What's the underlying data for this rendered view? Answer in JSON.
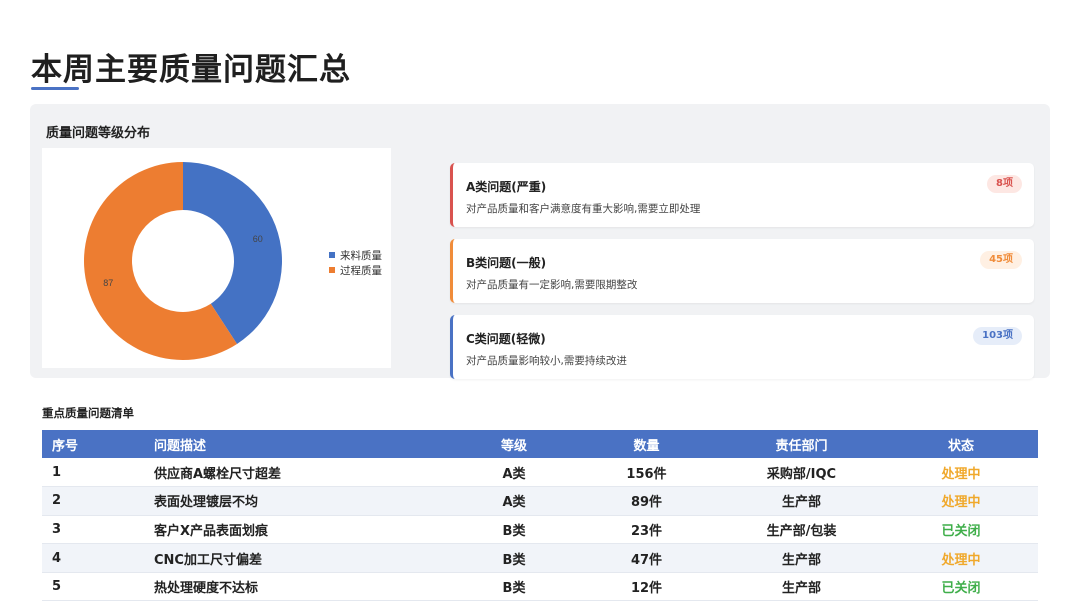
{
  "page": {
    "title": "本周主要质量问题汇总"
  },
  "distribution": {
    "title": "质量问题等级分布",
    "chart_data": {
      "type": "pie",
      "donut": true,
      "slices": [
        {
          "label": "来料质量",
          "value": 60,
          "color": "#4472c4"
        },
        {
          "label": "过程质量",
          "value": 87,
          "color": "#ed7d31"
        }
      ],
      "legend_placement": "right"
    }
  },
  "levels": [
    {
      "title": "A类问题(严重)",
      "desc": "对产品质量和客户满意度有重大影响,需要立即处理",
      "badge": "8项",
      "color": "#d9534f",
      "badge_bg": "#fde7e3",
      "badge_fg": "#d9534f"
    },
    {
      "title": "B类问题(一般)",
      "desc": "对产品质量有一定影响,需要限期整改",
      "badge": "45项",
      "color": "#f08c3a",
      "badge_bg": "#fff0e3",
      "badge_fg": "#f08c3a"
    },
    {
      "title": "C类问题(轻微)",
      "desc": "对产品质量影响较小,需要持续改进",
      "badge": "103项",
      "color": "#4a72c4",
      "badge_bg": "#e6edf9",
      "badge_fg": "#4a72c4"
    }
  ],
  "issue_list": {
    "title": "重点质量问题清单",
    "headers": {
      "no": "序号",
      "desc": "问题描述",
      "level": "等级",
      "qty": "数量",
      "dept": "责任部门",
      "status": "状态"
    },
    "rows": [
      {
        "no": "1",
        "desc": "供应商A螺栓尺寸超差",
        "level": "A类",
        "qty": "156件",
        "dept": "采购部/IQC",
        "status": "处理中",
        "status_type": "processing"
      },
      {
        "no": "2",
        "desc": "表面处理镀层不均",
        "level": "A类",
        "qty": "89件",
        "dept": "生产部",
        "status": "处理中",
        "status_type": "processing"
      },
      {
        "no": "3",
        "desc": "客户X产品表面划痕",
        "level": "B类",
        "qty": "23件",
        "dept": "生产部/包装",
        "status": "已关闭",
        "status_type": "closed"
      },
      {
        "no": "4",
        "desc": "CNC加工尺寸偏差",
        "level": "B类",
        "qty": "47件",
        "dept": "生产部",
        "status": "处理中",
        "status_type": "processing"
      },
      {
        "no": "5",
        "desc": "热处理硬度不达标",
        "level": "B类",
        "qty": "12件",
        "dept": "生产部",
        "status": "已关闭",
        "status_type": "closed"
      }
    ]
  }
}
